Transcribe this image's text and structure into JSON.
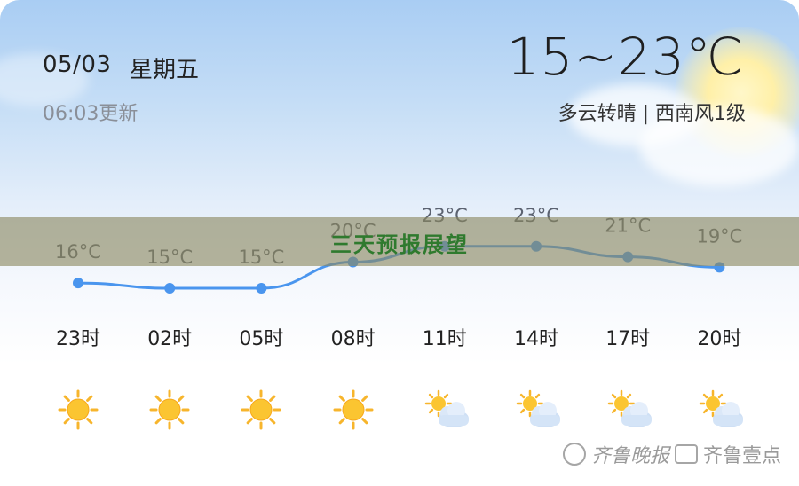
{
  "header": {
    "date": "05/03",
    "weekday": "星期五",
    "update_time": "06:03更新",
    "temp_range": "15~23℃",
    "condition": "多云转晴 | 西南风1级"
  },
  "banner": {
    "title": "三天预报展望"
  },
  "watermark": {
    "brand1": "齐鲁晚报",
    "brand2": "齐鲁壹点"
  },
  "colors": {
    "line": "#4a95ee",
    "banner": "#8a8860",
    "banner_text": "#2f7a2e"
  },
  "chart_data": {
    "type": "line",
    "x": [
      "23时",
      "02时",
      "05时",
      "08时",
      "11时",
      "14时",
      "17时",
      "20时"
    ],
    "series": [
      {
        "values": [
          16,
          15,
          15,
          20,
          23,
          23,
          21,
          19
        ]
      }
    ],
    "data_labels": [
      "16°C",
      "15°C",
      "15°C",
      "20°C",
      "23°C",
      "23°C",
      "21°C",
      "19°C"
    ],
    "icons": [
      "sun-icon",
      "sun-icon",
      "sun-icon",
      "sun-icon",
      "partly-cloudy-icon",
      "partly-cloudy-icon",
      "partly-cloudy-icon",
      "partly-cloudy-icon"
    ]
  }
}
